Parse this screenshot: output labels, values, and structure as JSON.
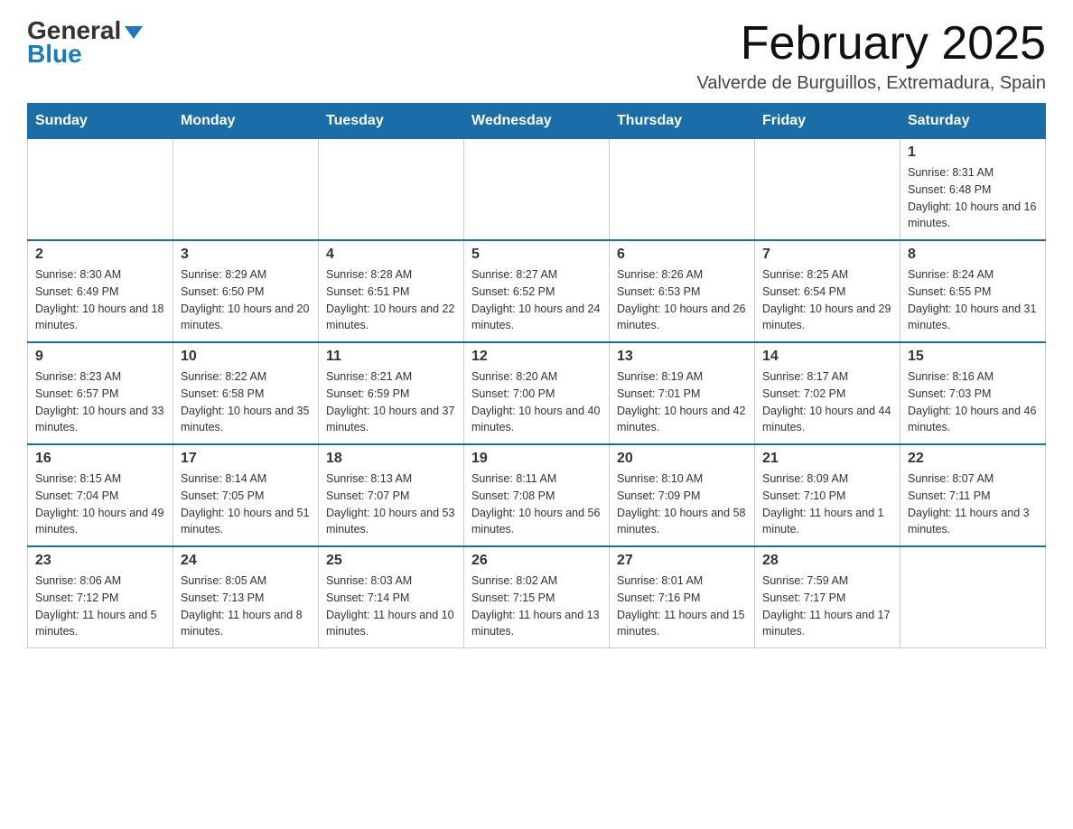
{
  "header": {
    "logo_general": "General",
    "logo_blue": "Blue",
    "month_title": "February 2025",
    "location": "Valverde de Burguillos, Extremadura, Spain"
  },
  "days_of_week": [
    "Sunday",
    "Monday",
    "Tuesday",
    "Wednesday",
    "Thursday",
    "Friday",
    "Saturday"
  ],
  "weeks": [
    [
      {
        "day": "",
        "info": ""
      },
      {
        "day": "",
        "info": ""
      },
      {
        "day": "",
        "info": ""
      },
      {
        "day": "",
        "info": ""
      },
      {
        "day": "",
        "info": ""
      },
      {
        "day": "",
        "info": ""
      },
      {
        "day": "1",
        "info": "Sunrise: 8:31 AM\nSunset: 6:48 PM\nDaylight: 10 hours and 16 minutes."
      }
    ],
    [
      {
        "day": "2",
        "info": "Sunrise: 8:30 AM\nSunset: 6:49 PM\nDaylight: 10 hours and 18 minutes."
      },
      {
        "day": "3",
        "info": "Sunrise: 8:29 AM\nSunset: 6:50 PM\nDaylight: 10 hours and 20 minutes."
      },
      {
        "day": "4",
        "info": "Sunrise: 8:28 AM\nSunset: 6:51 PM\nDaylight: 10 hours and 22 minutes."
      },
      {
        "day": "5",
        "info": "Sunrise: 8:27 AM\nSunset: 6:52 PM\nDaylight: 10 hours and 24 minutes."
      },
      {
        "day": "6",
        "info": "Sunrise: 8:26 AM\nSunset: 6:53 PM\nDaylight: 10 hours and 26 minutes."
      },
      {
        "day": "7",
        "info": "Sunrise: 8:25 AM\nSunset: 6:54 PM\nDaylight: 10 hours and 29 minutes."
      },
      {
        "day": "8",
        "info": "Sunrise: 8:24 AM\nSunset: 6:55 PM\nDaylight: 10 hours and 31 minutes."
      }
    ],
    [
      {
        "day": "9",
        "info": "Sunrise: 8:23 AM\nSunset: 6:57 PM\nDaylight: 10 hours and 33 minutes."
      },
      {
        "day": "10",
        "info": "Sunrise: 8:22 AM\nSunset: 6:58 PM\nDaylight: 10 hours and 35 minutes."
      },
      {
        "day": "11",
        "info": "Sunrise: 8:21 AM\nSunset: 6:59 PM\nDaylight: 10 hours and 37 minutes."
      },
      {
        "day": "12",
        "info": "Sunrise: 8:20 AM\nSunset: 7:00 PM\nDaylight: 10 hours and 40 minutes."
      },
      {
        "day": "13",
        "info": "Sunrise: 8:19 AM\nSunset: 7:01 PM\nDaylight: 10 hours and 42 minutes."
      },
      {
        "day": "14",
        "info": "Sunrise: 8:17 AM\nSunset: 7:02 PM\nDaylight: 10 hours and 44 minutes."
      },
      {
        "day": "15",
        "info": "Sunrise: 8:16 AM\nSunset: 7:03 PM\nDaylight: 10 hours and 46 minutes."
      }
    ],
    [
      {
        "day": "16",
        "info": "Sunrise: 8:15 AM\nSunset: 7:04 PM\nDaylight: 10 hours and 49 minutes."
      },
      {
        "day": "17",
        "info": "Sunrise: 8:14 AM\nSunset: 7:05 PM\nDaylight: 10 hours and 51 minutes."
      },
      {
        "day": "18",
        "info": "Sunrise: 8:13 AM\nSunset: 7:07 PM\nDaylight: 10 hours and 53 minutes."
      },
      {
        "day": "19",
        "info": "Sunrise: 8:11 AM\nSunset: 7:08 PM\nDaylight: 10 hours and 56 minutes."
      },
      {
        "day": "20",
        "info": "Sunrise: 8:10 AM\nSunset: 7:09 PM\nDaylight: 10 hours and 58 minutes."
      },
      {
        "day": "21",
        "info": "Sunrise: 8:09 AM\nSunset: 7:10 PM\nDaylight: 11 hours and 1 minute."
      },
      {
        "day": "22",
        "info": "Sunrise: 8:07 AM\nSunset: 7:11 PM\nDaylight: 11 hours and 3 minutes."
      }
    ],
    [
      {
        "day": "23",
        "info": "Sunrise: 8:06 AM\nSunset: 7:12 PM\nDaylight: 11 hours and 5 minutes."
      },
      {
        "day": "24",
        "info": "Sunrise: 8:05 AM\nSunset: 7:13 PM\nDaylight: 11 hours and 8 minutes."
      },
      {
        "day": "25",
        "info": "Sunrise: 8:03 AM\nSunset: 7:14 PM\nDaylight: 11 hours and 10 minutes."
      },
      {
        "day": "26",
        "info": "Sunrise: 8:02 AM\nSunset: 7:15 PM\nDaylight: 11 hours and 13 minutes."
      },
      {
        "day": "27",
        "info": "Sunrise: 8:01 AM\nSunset: 7:16 PM\nDaylight: 11 hours and 15 minutes."
      },
      {
        "day": "28",
        "info": "Sunrise: 7:59 AM\nSunset: 7:17 PM\nDaylight: 11 hours and 17 minutes."
      },
      {
        "day": "",
        "info": ""
      }
    ]
  ]
}
